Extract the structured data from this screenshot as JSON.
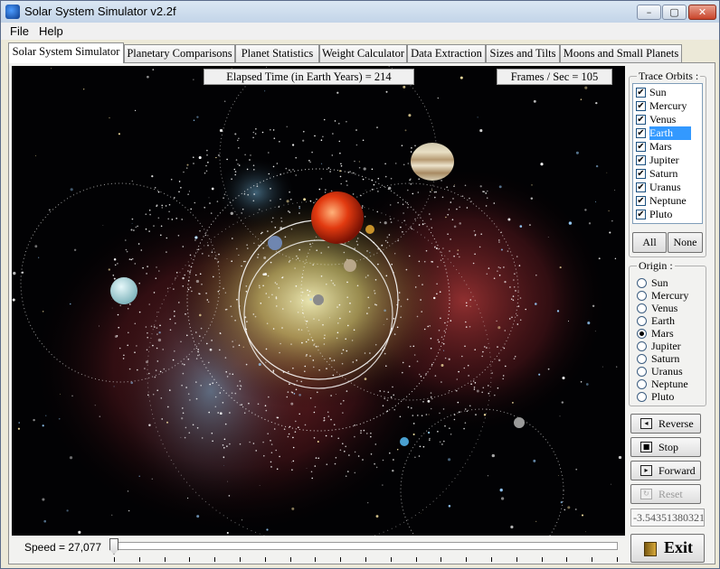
{
  "window": {
    "title": "Solar System Simulator v2.2f",
    "controls": [
      "–",
      "▢",
      "✕"
    ]
  },
  "menu": [
    "File",
    "Help"
  ],
  "tabs": [
    "Solar System Simulator",
    "Planetary Comparisons",
    "Planet Statistics",
    "Weight Calculator",
    "Data Extraction",
    "Sizes and Tilts",
    "Moons and Small Planets"
  ],
  "active_tab": 0,
  "hud": {
    "elapsed": "Elapsed Time (in Earth Years) = 214",
    "fps": "Frames / Sec = 105"
  },
  "trace_orbits": {
    "legend": "Trace Orbits :",
    "items": [
      {
        "label": "Sun",
        "checked": true
      },
      {
        "label": "Mercury",
        "checked": true
      },
      {
        "label": "Venus",
        "checked": true
      },
      {
        "label": "Earth",
        "checked": true,
        "selected": true
      },
      {
        "label": "Mars",
        "checked": true
      },
      {
        "label": "Jupiter",
        "checked": true
      },
      {
        "label": "Saturn",
        "checked": true
      },
      {
        "label": "Uranus",
        "checked": true
      },
      {
        "label": "Neptune",
        "checked": true
      },
      {
        "label": "Pluto",
        "checked": true
      }
    ],
    "all_label": "All",
    "none_label": "None",
    "check_glyph": "✔"
  },
  "origin": {
    "legend": "Origin :",
    "options": [
      "Sun",
      "Mercury",
      "Venus",
      "Earth",
      "Mars",
      "Jupiter",
      "Saturn",
      "Uranus",
      "Neptune",
      "Pluto"
    ],
    "selected": "Mars"
  },
  "controls": {
    "reverse": {
      "label": "Reverse",
      "icon": "◂"
    },
    "stop": {
      "label": "Stop",
      "icon": "■"
    },
    "forward": {
      "label": "Forward",
      "icon": "▸"
    },
    "reset": {
      "label": "Reset",
      "icon": "↻"
    }
  },
  "readout": "-3.54351380321",
  "exit_label": "Exit",
  "speed": {
    "label": "Speed = 27,077",
    "value": 0
  }
}
